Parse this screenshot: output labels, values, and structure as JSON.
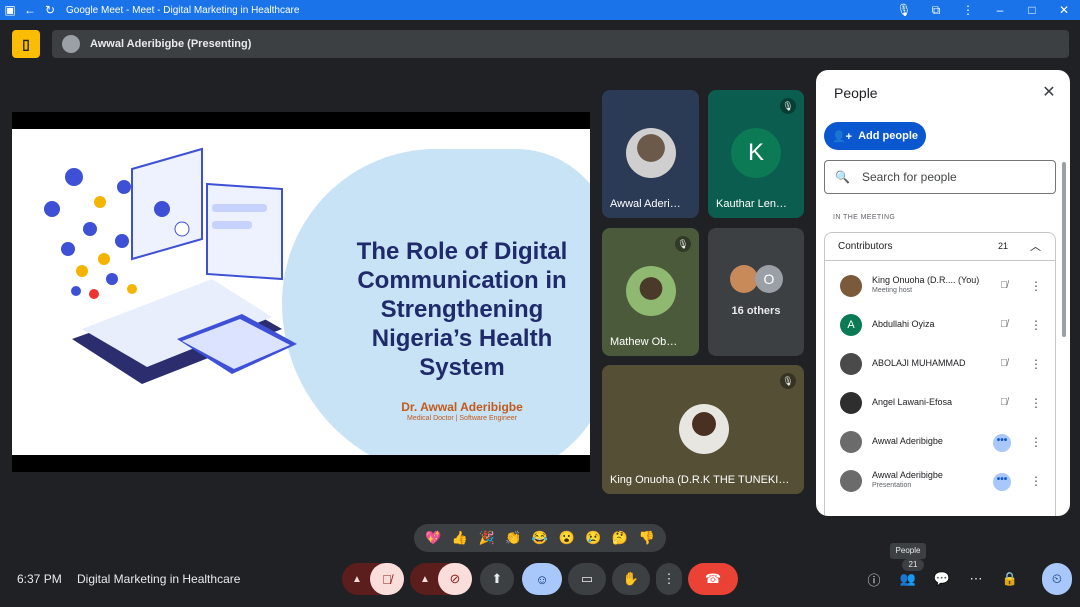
{
  "window": {
    "title": "Google Meet - Meet - Digital Marketing in Healthcare"
  },
  "presenting": {
    "text": "Awwal Aderibigbe (Presenting)"
  },
  "slide": {
    "title_lines": [
      "The Role of Digital",
      "Communication in",
      "Strengthening",
      "Nigeria’s Health",
      "System"
    ],
    "author": "Dr. Awwal Aderibigbe",
    "role": "Medical Doctor | Software Engineer"
  },
  "tiles": [
    {
      "name": "Awwal Aderi…"
    },
    {
      "name": "Kauthar Len…",
      "initial": "K"
    },
    {
      "name": "Mathew Ob…"
    },
    {
      "name": "16 others",
      "initial": "O"
    },
    {
      "name": "King Onuoha (D.R.K THE TUNEKI…"
    }
  ],
  "people_panel": {
    "heading": "People",
    "add_label": "Add people",
    "search_placeholder": "Search for people",
    "section_label": "IN THE MEETING",
    "group_label": "Contributors",
    "group_count": "21",
    "participants": [
      {
        "name": "King Onuoha (D.R.... (You)",
        "sub": "Meeting host",
        "avatar_color": "#7a5a3a"
      },
      {
        "name": "Abdullahi Oyiza",
        "sub": "",
        "avatar_color": "#0b7a55",
        "initial": "A"
      },
      {
        "name": "ABOLAJI MUHAMMAD",
        "sub": "",
        "avatar_color": "#4a4a4a"
      },
      {
        "name": "Angel Lawani-Efosa",
        "sub": "",
        "avatar_color": "#2e2e2e"
      },
      {
        "name": "Awwal Aderibigbe",
        "sub": "",
        "avatar_color": "#6b6b6b"
      },
      {
        "name": "Awwal Aderibigbe",
        "sub": "Presentation",
        "avatar_color": "#6b6b6b"
      }
    ]
  },
  "reactions": [
    "💖",
    "👍",
    "🎉",
    "👏",
    "😂",
    "😮",
    "😢",
    "🤔",
    "👎"
  ],
  "bottom": {
    "time": "6:37 PM",
    "meeting_name": "Digital Marketing in Healthcare",
    "tooltip": "People",
    "people_count": "21"
  },
  "colors": {
    "accent": "#1a73e8",
    "end_call": "#ea4335",
    "mic_off_bg": "#f9dedc",
    "reaction_active": "#a8c7fa"
  }
}
